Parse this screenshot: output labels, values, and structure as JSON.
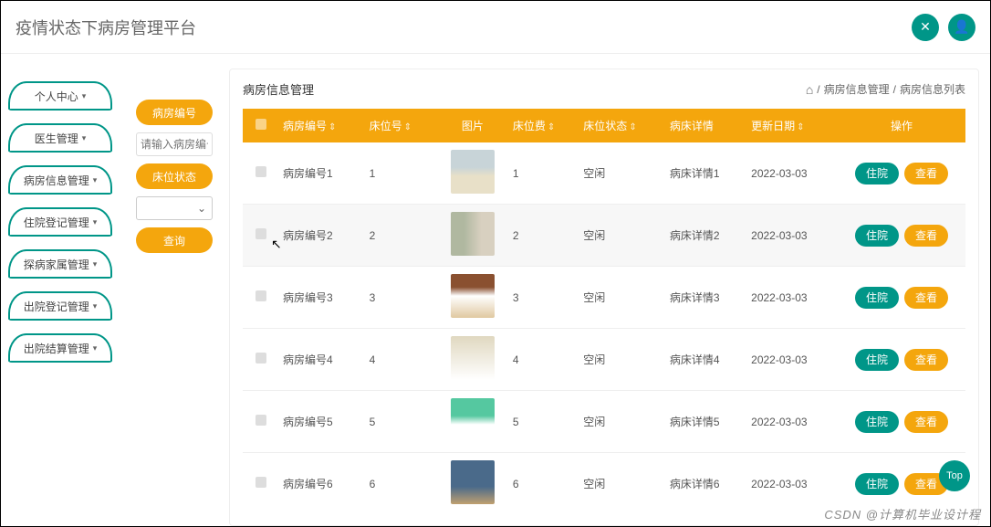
{
  "header": {
    "title": "疫情状态下病房管理平台"
  },
  "topIcons": {
    "settings": "✕",
    "user": "👤"
  },
  "sidebar": {
    "items": [
      {
        "label": "个人中心"
      },
      {
        "label": "医生管理"
      },
      {
        "label": "病房信息管理"
      },
      {
        "label": "住院登记管理"
      },
      {
        "label": "探病家属管理"
      },
      {
        "label": "出院登记管理"
      },
      {
        "label": "出院结算管理"
      }
    ]
  },
  "filter": {
    "label1": "病房编号",
    "placeholder": "请输入病房编号",
    "label2": "床位状态",
    "search": "查询"
  },
  "page": {
    "title": "病房信息管理",
    "crumb1": "病房信息管理",
    "crumb2": "病房信息列表"
  },
  "table": {
    "headers": {
      "room": "病房编号",
      "bed": "床位号",
      "img": "图片",
      "fee": "床位费",
      "status": "床位状态",
      "detail": "病床详情",
      "date": "更新日期",
      "ops": "操作"
    },
    "rows": [
      {
        "room": "病房编号1",
        "bed": "1",
        "fee": "1",
        "status": "空闲",
        "detail": "病床详情1",
        "date": "2022-03-03",
        "img": "a"
      },
      {
        "room": "病房编号2",
        "bed": "2",
        "fee": "2",
        "status": "空闲",
        "detail": "病床详情2",
        "date": "2022-03-03",
        "img": "b",
        "sel": true
      },
      {
        "room": "病房编号3",
        "bed": "3",
        "fee": "3",
        "status": "空闲",
        "detail": "病床详情3",
        "date": "2022-03-03",
        "img": "c"
      },
      {
        "room": "病房编号4",
        "bed": "4",
        "fee": "4",
        "status": "空闲",
        "detail": "病床详情4",
        "date": "2022-03-03",
        "img": "d"
      },
      {
        "room": "病房编号5",
        "bed": "5",
        "fee": "5",
        "status": "空闲",
        "detail": "病床详情5",
        "date": "2022-03-03",
        "img": "e"
      },
      {
        "room": "病房编号6",
        "bed": "6",
        "fee": "6",
        "status": "空闲",
        "detail": "病床详情6",
        "date": "2022-03-03",
        "img": "f"
      }
    ],
    "actions": {
      "checkin": "住院",
      "view": "查看"
    }
  },
  "fab": "Top",
  "watermark": "CSDN @计算机毕业设计程"
}
